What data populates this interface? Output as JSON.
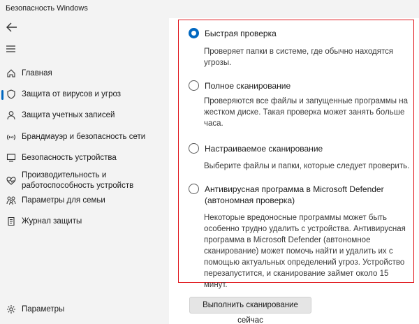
{
  "window": {
    "title": "Безопасность Windows"
  },
  "sidebar": {
    "back_icon": "back-arrow-icon",
    "menu_icon": "hamburger-icon",
    "items": [
      {
        "label": "Главная",
        "icon": "home-icon"
      },
      {
        "label": "Защита от вирусов и угроз",
        "icon": "shield-icon",
        "active": true
      },
      {
        "label": "Защита учетных записей",
        "icon": "person-icon"
      },
      {
        "label": "Брандмауэр и безопасность сети",
        "icon": "wifi-icon"
      },
      {
        "label": "Безопасность устройства",
        "icon": "monitor-icon"
      },
      {
        "label": "Производительность и работоспособность устройств",
        "icon": "heart-icon"
      },
      {
        "label": "Параметры для семьи",
        "icon": "family-icon"
      },
      {
        "label": "Журнал защиты",
        "icon": "history-icon"
      }
    ],
    "settings_label": "Параметры",
    "settings_icon": "gear-icon"
  },
  "scan_options": [
    {
      "label": "Быстрая проверка",
      "description": "Проверяет папки в системе, где обычно находятся угрозы.",
      "selected": true
    },
    {
      "label": "Полное сканирование",
      "description": "Проверяются все файлы и запущенные программы на жестком диске. Такая проверка может занять больше часа.",
      "selected": false
    },
    {
      "label": "Настраиваемое сканирование",
      "description": "Выберите файлы и папки, которые следует проверить.",
      "selected": false
    },
    {
      "label": "Антивирусная программа в Microsoft Defender (автономная проверка)",
      "description": "Некоторые вредоносные программы может быть особенно трудно удалить с устройства. Антивирусная программа в Microsoft Defender (автономное сканирование) может помочь найти и удалить их с помощью актуальных определений угроз. Устройство перезапустится, и сканирование займет около 15 минут.",
      "selected": false
    }
  ],
  "scan_button": {
    "label": "Выполнить сканирование сейчас"
  },
  "colors": {
    "accent": "#0067c0",
    "highlight_box": "#e0161c",
    "sidebar_bg": "#f3f3f3"
  }
}
